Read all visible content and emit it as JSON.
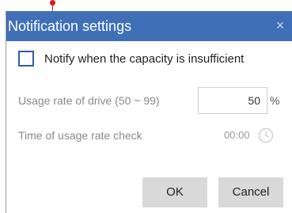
{
  "dialog": {
    "title": "Notification settings",
    "close_glyph": "×"
  },
  "notify_checkbox": {
    "label": "Notify when the capacity is insufficient",
    "checked": false
  },
  "usage_rate": {
    "label": "Usage rate of drive (50 ~ 99)",
    "value": "50",
    "unit": "%"
  },
  "usage_check_time": {
    "label": "Time of usage rate check",
    "value": "00:00",
    "icon": "clock-icon"
  },
  "buttons": {
    "ok": "OK",
    "cancel": "Cancel"
  },
  "colors": {
    "titlebar": "#3f70b7",
    "checkbox_border": "#2f5e9e",
    "button_bg": "#d9d9d9",
    "marker": "#d7191c"
  }
}
